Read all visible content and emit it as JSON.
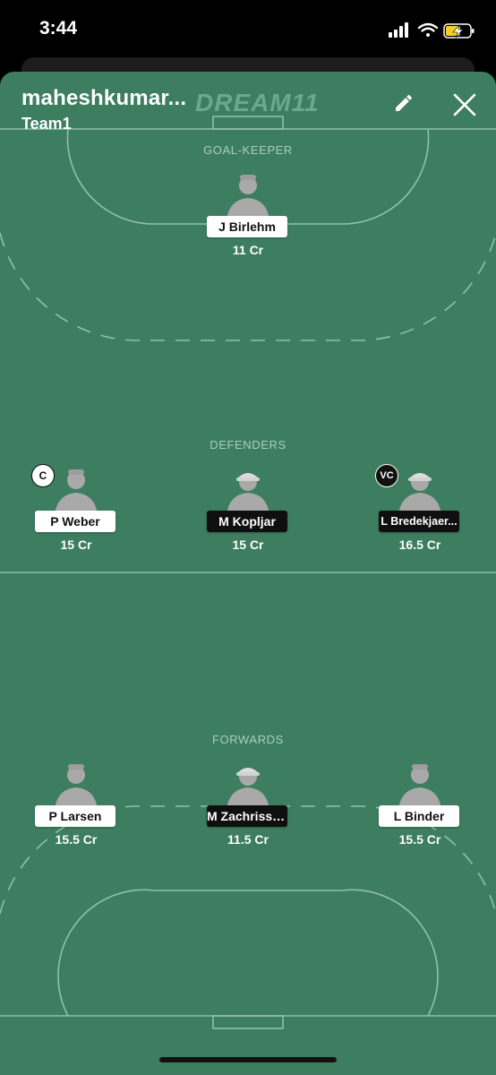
{
  "status_bar": {
    "time": "3:44"
  },
  "header": {
    "team_owner": "maheshkumar...",
    "team_name": "Team1",
    "brand": "DREAM11"
  },
  "sections": {
    "goalkeeper": "GOAL-KEEPER",
    "defenders": "DEFENDERS",
    "forwards": "FORWARDS"
  },
  "players": {
    "gk": {
      "name": "J Birlehm",
      "credits": "11 Cr",
      "tag": "white"
    },
    "def1": {
      "name": "P Weber",
      "credits": "15 Cr",
      "tag": "white",
      "badge": "C"
    },
    "def2": {
      "name": "M Kopljar",
      "credits": "15 Cr",
      "tag": "black"
    },
    "def3": {
      "name": "L Bredekjaer...",
      "credits": "16.5 Cr",
      "tag": "black",
      "badge": "VC"
    },
    "fwd1": {
      "name": "P Larsen",
      "credits": "15.5 Cr",
      "tag": "white"
    },
    "fwd2": {
      "name": "M Zachrisson",
      "credits": "11.5 Cr",
      "tag": "black"
    },
    "fwd3": {
      "name": "L Binder",
      "credits": "15.5 Cr",
      "tag": "white"
    }
  },
  "colors": {
    "pitch": "#3d7d60",
    "lines": "#8fc1a9",
    "tag_white": "#ffffff",
    "tag_black": "#0f0f0f"
  }
}
